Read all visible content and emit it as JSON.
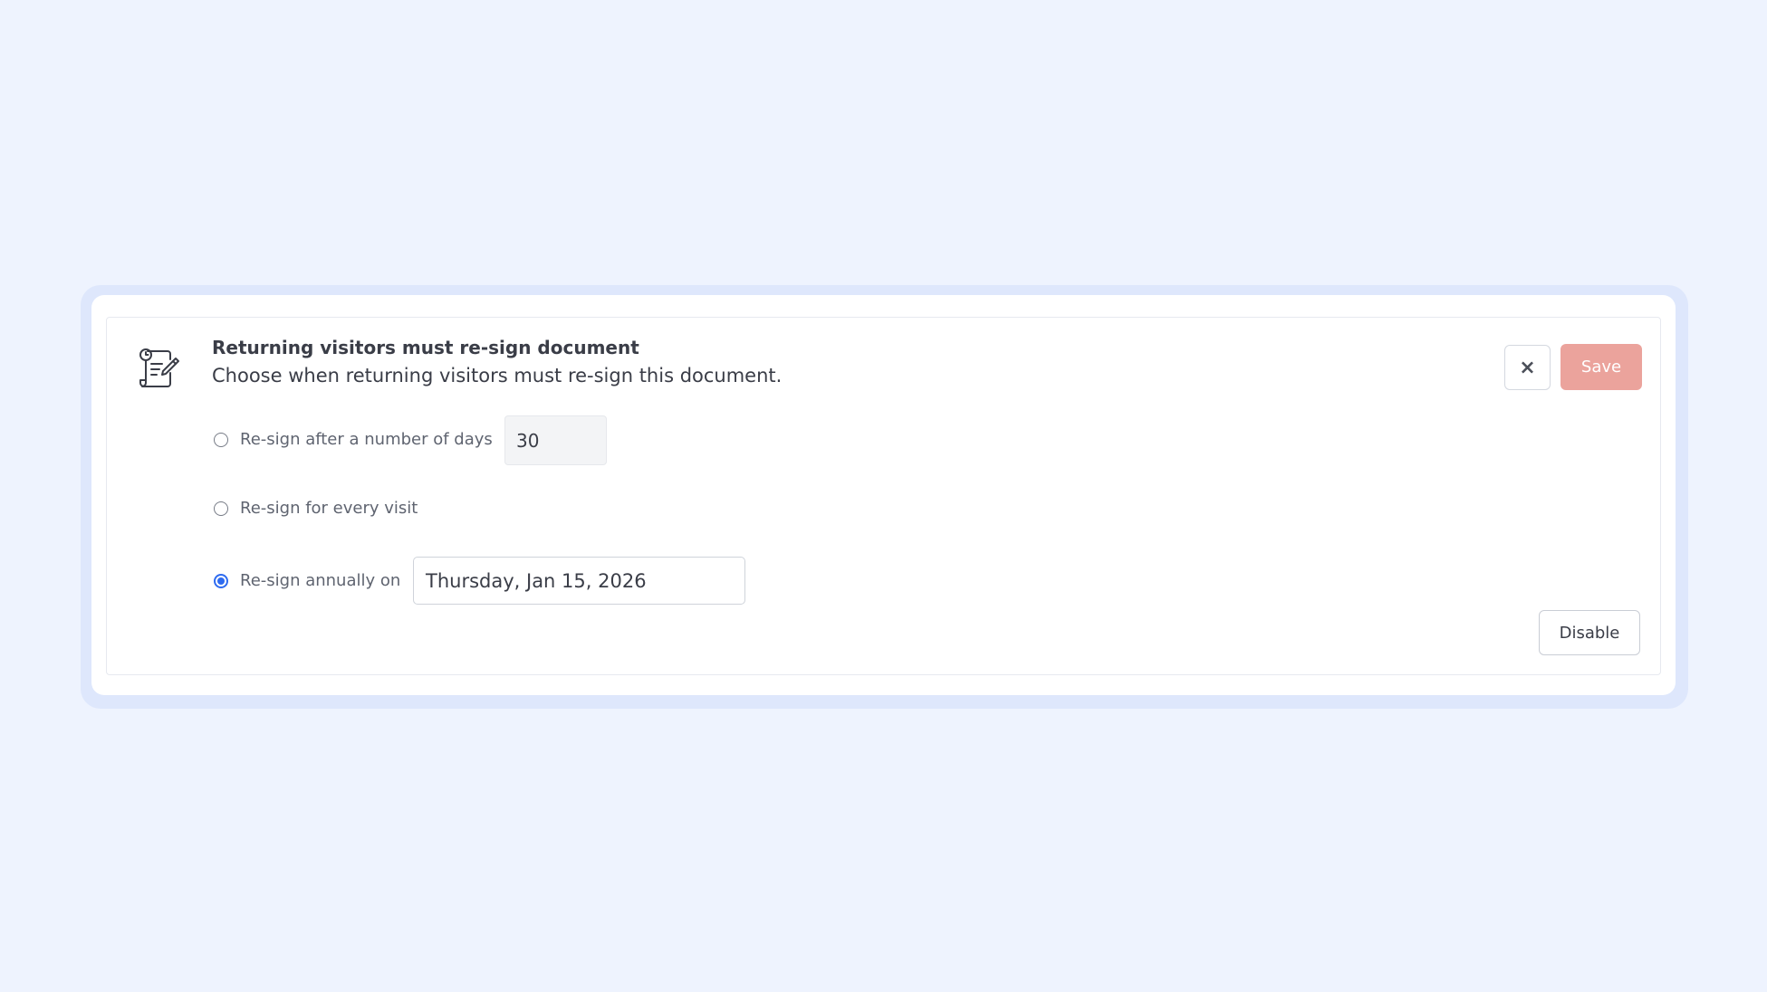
{
  "card": {
    "title": "Returning visitors must re-sign document",
    "subtitle": "Choose when returning visitors must re-sign this document."
  },
  "actions": {
    "close_label": "×",
    "save_label": "Save",
    "disable_label": "Disable"
  },
  "options": [
    {
      "label": "Re-sign after a number of days",
      "selected": false,
      "value": "30"
    },
    {
      "label": "Re-sign for every visit",
      "selected": false
    },
    {
      "label": "Re-sign annually on",
      "selected": true,
      "value": "Thursday, Jan 15, 2026"
    }
  ],
  "icons": {
    "document": "document-sign-icon",
    "close": "close-icon"
  },
  "colors": {
    "background": "#eef3fe",
    "frame": "#dee7fc",
    "save_button": "#eba39c",
    "radio_selected": "#2e6bf0"
  }
}
